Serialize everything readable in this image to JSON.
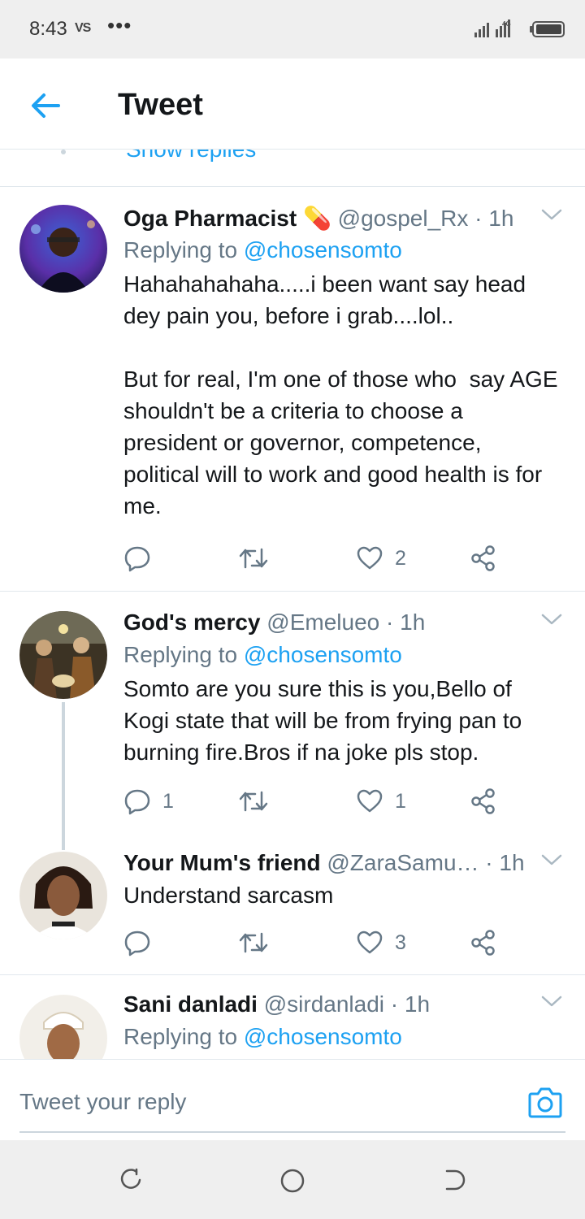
{
  "status_bar": {
    "time": "8:43",
    "carrier_badge": "VS",
    "more_dots": "•••",
    "network": "4G"
  },
  "header": {
    "title": "Tweet"
  },
  "show_replies": "Show replies",
  "tweets": [
    {
      "name": "Oga Pharmacist",
      "emoji": "💊",
      "handle": "@gospel_Rx",
      "time": "· 1h",
      "replying_prefix": "Replying to ",
      "replying_to": "@chosensomto",
      "text": "Hahahahahaha.....i been want say head dey pain you, before i grab....lol..\n\nBut for real, I'm one of those who  say AGE shouldn't be a criteria to choose a president or governor, competence, political will to work and good health is for me.",
      "replies": "",
      "retweets": "",
      "likes": "2"
    },
    {
      "name": "God's mercy",
      "handle": "@Emelueo",
      "time": "· 1h",
      "replying_prefix": "Replying to ",
      "replying_to": "@chosensomto",
      "text": "Somto are you sure this is you,Bello of Kogi state that will be from frying pan to burning fire.Bros if na joke pls stop.",
      "replies": "1",
      "retweets": "",
      "likes": "1"
    },
    {
      "name": "Your Mum's friend",
      "handle": "@ZaraSamu…",
      "time": "· 1h",
      "text": "Understand sarcasm",
      "replies": "",
      "retweets": "",
      "likes": "3"
    },
    {
      "name": "Sani danladi",
      "handle": "@sirdanladi",
      "time": "· 1h",
      "replying_prefix": "Replying to ",
      "replying_to": "@chosensomto"
    }
  ],
  "reply_bar": {
    "placeholder": "Tweet your reply"
  },
  "colors": {
    "accent": "#1da1f2",
    "secondary_text": "#657786",
    "divider": "#e1e8ed"
  }
}
